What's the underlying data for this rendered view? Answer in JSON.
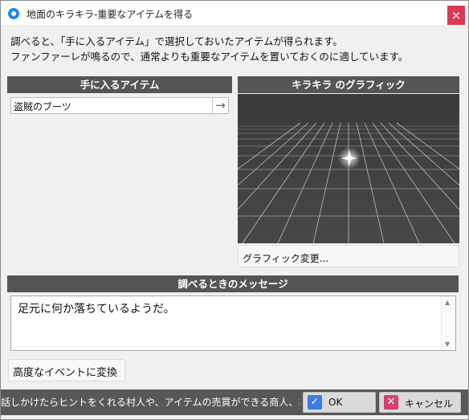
{
  "window": {
    "title": "地面のキラキラ-重要なアイテムを得る",
    "close_symbol": "×"
  },
  "description": {
    "line1": "調べると、「手に入るアイテム」で選択しておいたアイテムが得られます。",
    "line2": "ファンファーレが鳴るので、通常よりも重要なアイテムを置いておくのに適しています。"
  },
  "item_section": {
    "header": "手に入るアイテム",
    "selected_item": "盗賊のブーツ",
    "arrow_symbol": "→"
  },
  "graphic_section": {
    "header": "キラキラ のグラフィック",
    "change_button": "グラフィック変更..."
  },
  "message_section": {
    "header": "調べるときのメッセージ",
    "text": "足元に何か落ちているようだ。"
  },
  "advanced_button": "高度なイベントに変換",
  "footer": {
    "tip": "話しかけたらヒントをくれる村人や、アイテムの売買ができる商人、お金が",
    "ok_label": "OK",
    "cancel_label": "キャンセル"
  },
  "colors": {
    "header_bg": "#555555",
    "ok_icon": "#3b7be8",
    "cancel_icon": "#d2416e",
    "close_bg": "#d83a52"
  }
}
